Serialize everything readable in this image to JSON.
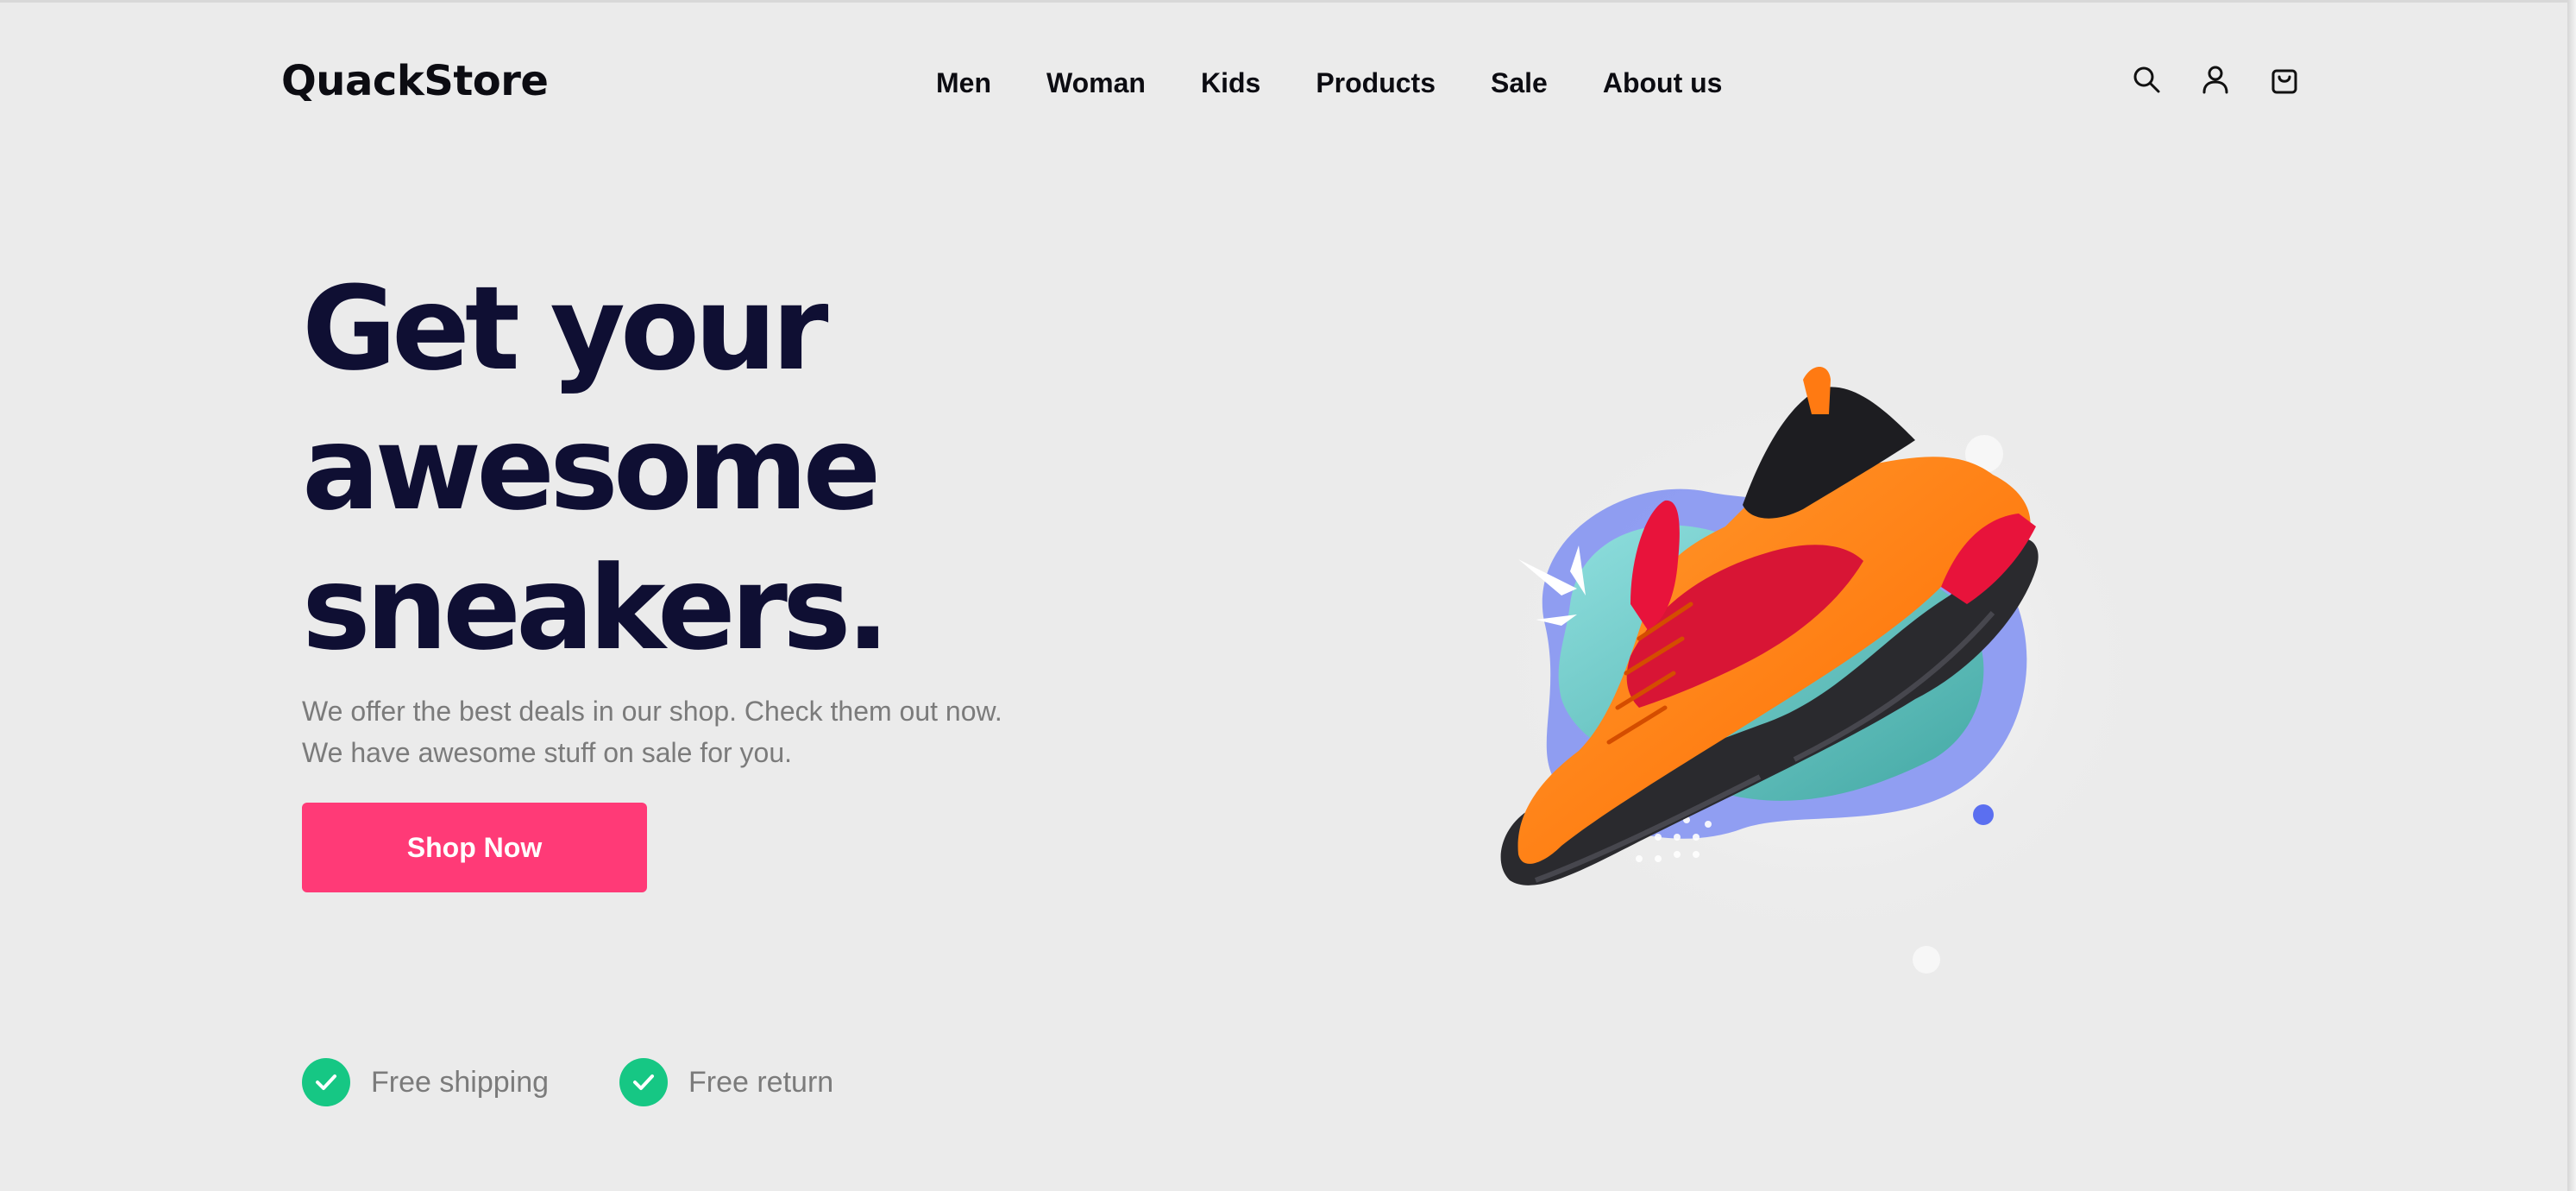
{
  "header": {
    "brand": "QuackStore",
    "nav": [
      "Men",
      "Woman",
      "Kids",
      "Products",
      "Sale",
      "About us"
    ],
    "icons": [
      "search-icon",
      "user-icon",
      "shopping-bag-icon"
    ]
  },
  "hero": {
    "title_lines": [
      "Get your",
      "awesome",
      "sneakers."
    ],
    "subtitle_lines": [
      "We offer the best deals in our shop. Check them out now.",
      "We have awesome stuff on sale for you."
    ],
    "cta_label": "Shop Now"
  },
  "perks": [
    "Free shipping",
    "Free return"
  ],
  "colors": {
    "background": "#ebebeb",
    "headline": "#0f0f33",
    "cta": "#ff3a77",
    "check": "#16c784",
    "muted_text": "#7b7b7b",
    "sneaker_primary": "#ff7a12",
    "sneaker_sole": "#2a2a2e",
    "sneaker_accent": "#e8133b"
  }
}
